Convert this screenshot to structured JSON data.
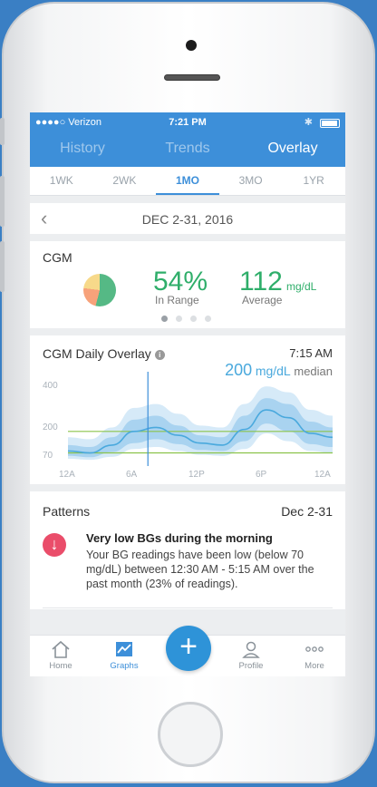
{
  "status": {
    "carrier": "●●●●○ Verizon",
    "time": "7:21 PM",
    "bluetooth_icon": "bluetooth-icon",
    "battery_icon": "battery-icon"
  },
  "tabs": [
    {
      "label": "History",
      "active": false
    },
    {
      "label": "Trends",
      "active": false
    },
    {
      "label": "Overlay",
      "active": true
    }
  ],
  "periods": [
    {
      "label": "1WK",
      "active": false
    },
    {
      "label": "2WK",
      "active": false
    },
    {
      "label": "1MO",
      "active": true
    },
    {
      "label": "3MO",
      "active": false
    },
    {
      "label": "1YR",
      "active": false
    }
  ],
  "date_range": {
    "label": "DEC 2-31, 2016",
    "back_icon": "chevron-left-icon"
  },
  "cgm": {
    "title": "CGM",
    "in_range_value": "54%",
    "in_range_label": "In Range",
    "average_value": "112",
    "average_unit": "mg/dL",
    "average_label": "Average",
    "pie": [
      {
        "label": "In Range",
        "value": 54,
        "color": "#55b985"
      },
      {
        "label": "High",
        "value": 23,
        "color": "#f7a27a"
      },
      {
        "label": "Low",
        "value": 23,
        "color": "#f7d98a"
      }
    ],
    "page_dots": 4,
    "active_dot": 0
  },
  "overlay": {
    "title": "CGM Daily Overlay",
    "info_icon": "info-icon",
    "cursor_time": "7:15 AM",
    "median_value": "200",
    "median_unit": "mg/dL",
    "median_label": "median"
  },
  "chart_data": {
    "type": "area",
    "title": "CGM Daily Overlay",
    "y_ticks": [
      "400",
      "200",
      "70"
    ],
    "x_ticks": [
      "12A",
      "6A",
      "12P",
      "6P",
      "12A"
    ],
    "target_range": [
      70,
      180
    ],
    "x": [
      0,
      2,
      4,
      6,
      8,
      10,
      12,
      14,
      16,
      18,
      20,
      22,
      24
    ],
    "median": [
      80,
      70,
      110,
      180,
      200,
      160,
      120,
      110,
      190,
      290,
      250,
      170,
      150
    ],
    "inner_low": [
      55,
      48,
      75,
      120,
      140,
      115,
      85,
      80,
      130,
      220,
      180,
      115,
      100
    ],
    "inner_high": [
      110,
      100,
      150,
      240,
      260,
      210,
      160,
      150,
      260,
      350,
      320,
      230,
      200
    ],
    "outer_low": [
      40,
      35,
      50,
      90,
      100,
      80,
      60,
      55,
      90,
      170,
      130,
      80,
      70
    ],
    "outer_high": [
      150,
      140,
      200,
      300,
      320,
      270,
      210,
      200,
      320,
      410,
      380,
      290,
      260
    ],
    "cursor_x": 7.25,
    "colors": {
      "median": "#4aa9dd",
      "inner": "#a9d3f0",
      "outer": "#d6eaf8",
      "target": "#8bc34a",
      "cursor": "#3d8fd9"
    }
  },
  "patterns": {
    "title": "Patterns",
    "range": "Dec 2-31",
    "alert_icon": "arrow-down-icon",
    "headline": "Very low BGs during the morning",
    "body": "Your BG readings have been low (below 70 mg/dL) between 12:30 AM - 5:15 AM over the past month (23% of readings)."
  },
  "nav": [
    {
      "label": "Home",
      "icon": "home-icon",
      "active": false
    },
    {
      "label": "Graphs",
      "icon": "graph-icon",
      "active": true
    },
    {
      "label": "Profile",
      "icon": "profile-icon",
      "active": false
    },
    {
      "label": "More",
      "icon": "more-icon",
      "active": false
    }
  ],
  "fab_icon": "plus-icon"
}
